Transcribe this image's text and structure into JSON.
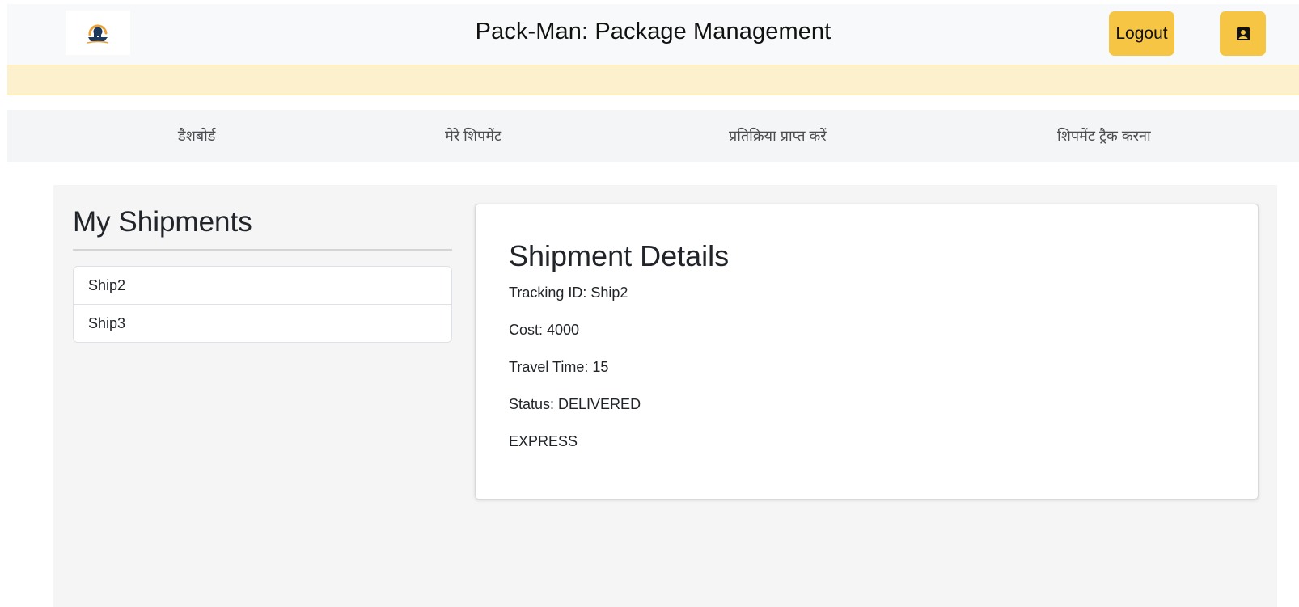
{
  "header": {
    "title": "Pack-Man: Package Management",
    "logout_label": "Logout",
    "logo_icon": "ship-logo-icon",
    "profile_icon": "person-badge-icon"
  },
  "colors": {
    "accent": "#f7c544",
    "alert_bg": "#fdf1cd",
    "header_bg": "#f8f9fa",
    "main_bg": "#f5f5f5"
  },
  "nav": {
    "items": [
      {
        "label": "डैशबोर्ड"
      },
      {
        "label": "मेरे शिपमेंट"
      },
      {
        "label": "प्रतिक्रिया प्राप्त करें"
      },
      {
        "label": "शिपमेंट ट्रैक करना"
      }
    ]
  },
  "sidebar": {
    "title": "My Shipments",
    "items": [
      {
        "label": "Ship2"
      },
      {
        "label": "Ship3"
      }
    ]
  },
  "details": {
    "title": "Shipment Details",
    "tracking_id": "Tracking ID: Ship2",
    "cost": "Cost: 4000",
    "travel_time": "Travel Time: 15",
    "status": "Status: DELIVERED",
    "type": "EXPRESS"
  }
}
